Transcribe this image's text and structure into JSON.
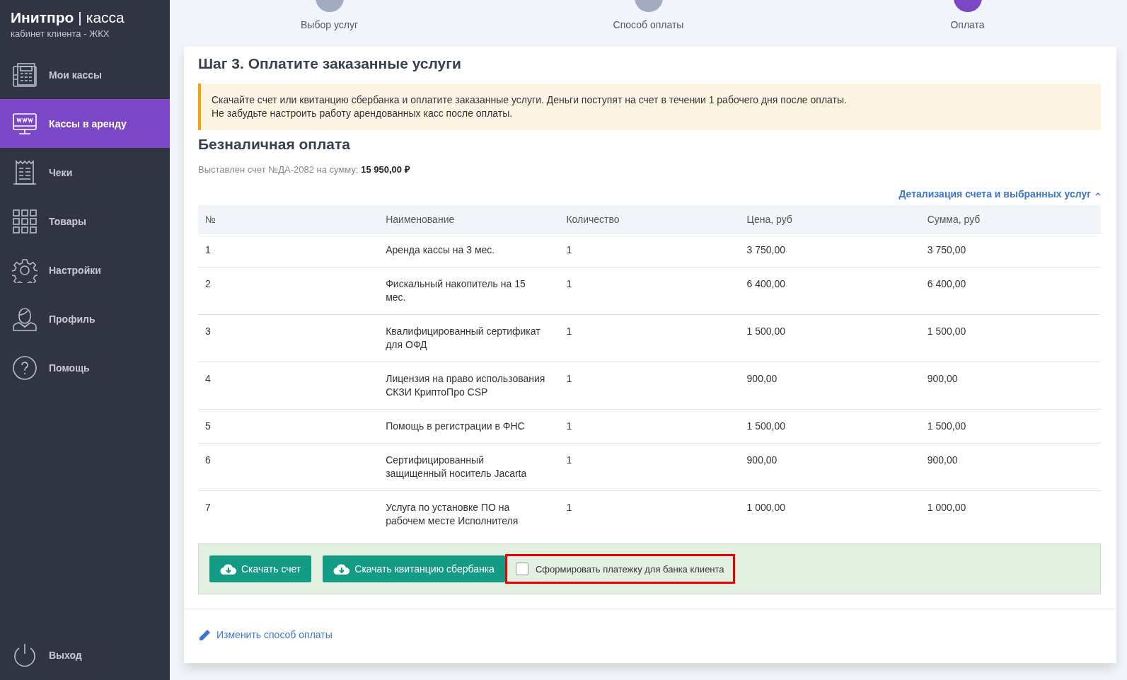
{
  "sidebar": {
    "logo_brand": "Инитпро",
    "logo_separator": "|",
    "logo_product": "касса",
    "subtitle": "кабинет клиента - ЖКХ",
    "items": [
      {
        "kind": "register",
        "label": "Мои кассы",
        "selected": false
      },
      {
        "kind": "monitor",
        "label": "Кассы в аренду",
        "selected": true
      },
      {
        "kind": "receipt",
        "label": "Чеки",
        "selected": false
      },
      {
        "kind": "grid",
        "label": "Товары",
        "selected": false
      },
      {
        "kind": "gear",
        "label": "Настройки",
        "selected": false
      },
      {
        "kind": "person",
        "label": "Профиль",
        "selected": false
      },
      {
        "kind": "help",
        "label": "Помощь",
        "selected": false
      }
    ],
    "logout": {
      "label": "Выход"
    }
  },
  "steps": [
    {
      "label": "Выбор услуг",
      "selected": false
    },
    {
      "label": "Способ оплаты",
      "selected": false
    },
    {
      "label": "Оплата",
      "selected": true
    }
  ],
  "card": {
    "title": "Шаг 3. Оплатите заказанные услуги",
    "alert": [
      "Скачайте счет или квитанцию сбербанка и оплатите заказанные услуги. Деньги поступят на счет в течении 1 рабочего дня после оплаты.",
      "Не забудьте настроить работу арендованных касс после оплаты."
    ],
    "section_title": "Безналичная оплата",
    "invoice": "Выставлен счет №ДА-2082 на сумму: **15 950,00 ₽**",
    "details_link": {
      "label": "Детализация счета и выбранных услуг",
      "expanded": true
    },
    "table": {
      "columns": [
        "№",
        "Наименование",
        "Количество",
        "Цена, руб",
        "Сумма, руб"
      ],
      "rows": [
        [
          "1",
          "Аренда кассы на 3 мес.",
          "1",
          "3 750,00",
          "3 750,00"
        ],
        [
          "2",
          "Фискальный накопитель на 15 мес.",
          "1",
          "6 400,00",
          "6 400,00"
        ],
        [
          "3",
          "Квалифицированный сертификат для ОФД",
          "1",
          "1 500,00",
          "1 500,00"
        ],
        [
          "4",
          "Лицензия на право использования СКЗИ КриптоПро CSP",
          "1",
          "900,00",
          "900,00"
        ],
        [
          "5",
          "Помощь в регистрации в ФНС",
          "1",
          "1 500,00",
          "1 500,00"
        ],
        [
          "6",
          "Сертифицированный защищенный носитель Jacarta",
          "1",
          "900,00",
          "900,00"
        ],
        [
          "7",
          "Услуга по установке ПО на рабочем месте Исполнителя",
          "1",
          "1 000,00",
          "1 000,00"
        ]
      ]
    },
    "buttons": [
      "Скачать счет",
      "Скачать квитанцию сбербанка"
    ],
    "checkbox": {
      "label": "Сформировать платежку для банка клиента",
      "checked": false,
      "highlighted": true
    },
    "change_link": "Изменить способ оплаты"
  }
}
